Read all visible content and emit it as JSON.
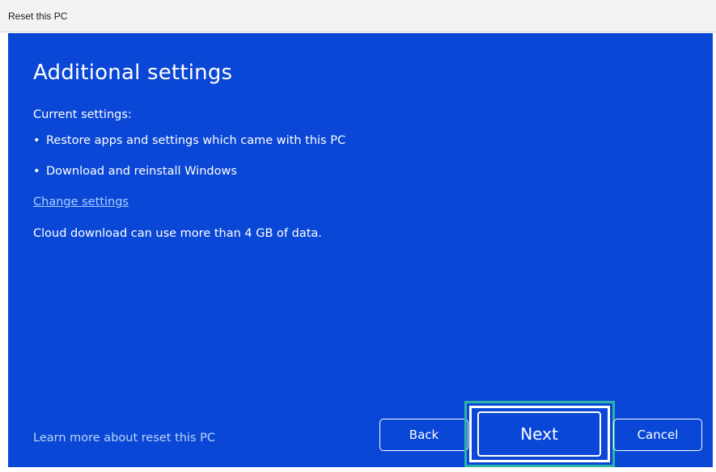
{
  "window": {
    "title": "Reset this PC"
  },
  "main": {
    "heading": "Additional settings",
    "current_settings_label": "Current settings:",
    "settings": [
      "Restore apps and settings which came with this PC",
      "Download and reinstall Windows"
    ],
    "change_link": "Change settings",
    "cloud_note": "Cloud download can use more than 4 GB of data."
  },
  "footer": {
    "learn_more": "Learn more about reset this PC",
    "back_label": "Back",
    "next_label": "Next",
    "cancel_label": "Cancel"
  },
  "colors": {
    "panel_background": "#0a47d6",
    "highlight": "#2db5a3",
    "link": "#a9d2ff"
  }
}
